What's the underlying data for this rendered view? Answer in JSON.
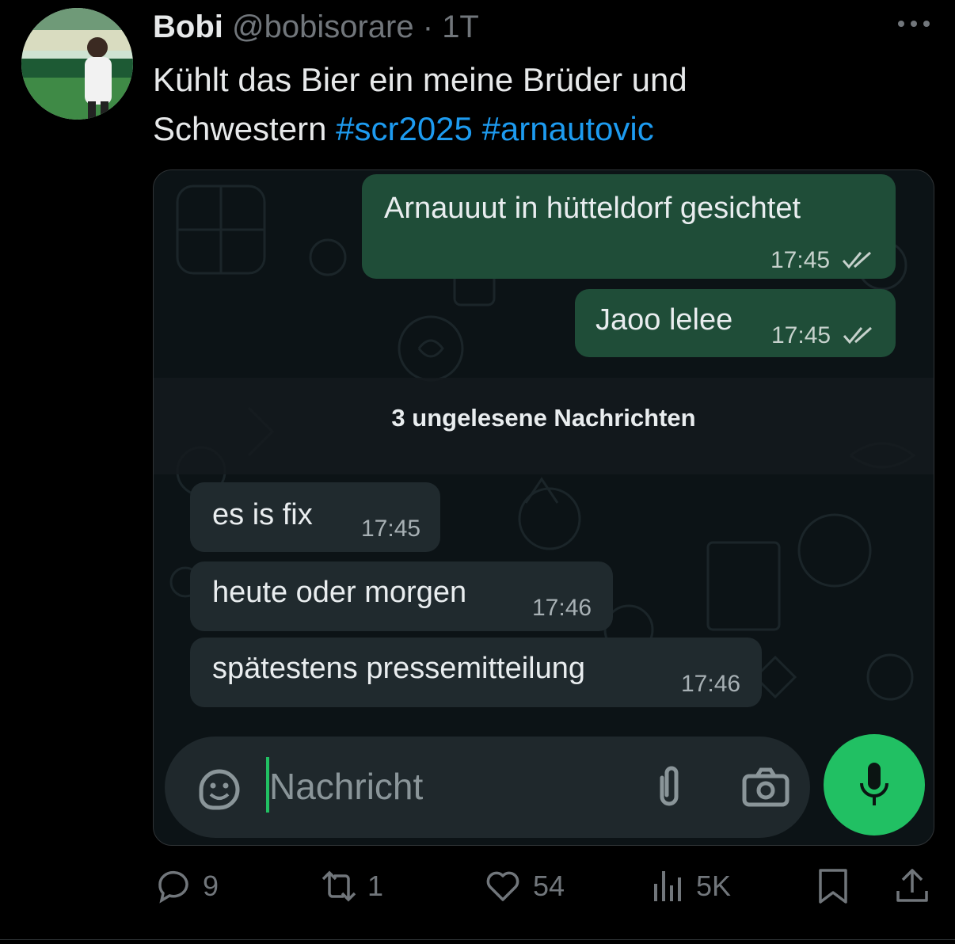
{
  "tweet": {
    "author_name": "Bobi",
    "handle": "@bobisorare",
    "separator": "·",
    "time": "1T",
    "text_before": "Kühlt das Bier ein meine Brüder und Schwestern ",
    "hashtags": [
      "#scr2025",
      "#arnautovic"
    ]
  },
  "chat": {
    "outgoing": [
      {
        "text": "Arnauuut in hütteldorf gesichtet",
        "time": "17:45"
      },
      {
        "text": "Jaoo lelee",
        "time": "17:45"
      }
    ],
    "unread_label": "3 ungelesene Nachrichten",
    "incoming": [
      {
        "text": "es is fix",
        "time": "17:45"
      },
      {
        "text": "heute oder morgen",
        "time": "17:46"
      },
      {
        "text": "spätestens pressemitteilung",
        "time": "17:46"
      }
    ],
    "input_placeholder": "Nachricht",
    "accent_color": "#21c063",
    "outgoing_bubble_color": "#1f4d38",
    "incoming_bubble_color": "#202a2e",
    "icons": [
      "sticker-icon",
      "attach-icon",
      "camera-icon",
      "mic-icon"
    ]
  },
  "actions": {
    "replies": "9",
    "reposts": "1",
    "likes": "54",
    "views": "5K"
  },
  "colors": {
    "background": "#000000",
    "hashtag": "#1d9bf0",
    "muted": "#71767b"
  }
}
